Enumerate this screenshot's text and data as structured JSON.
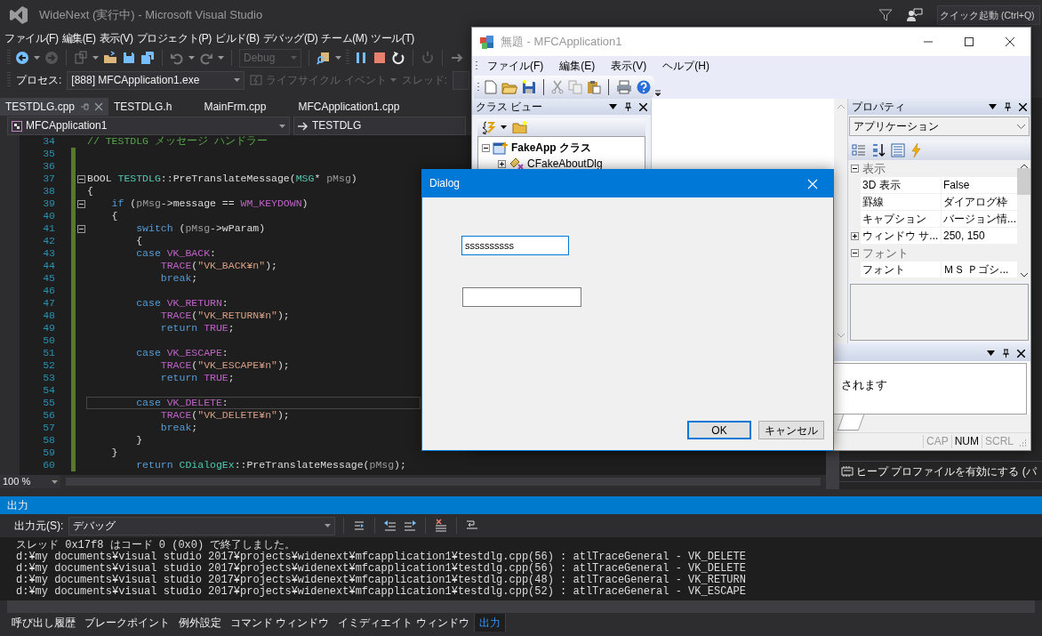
{
  "vs": {
    "title": "WideNext (実行中) - Microsoft Visual Studio",
    "quick_launch": {
      "placeholder": "クイック起動 (Ctrl+Q)"
    },
    "menu": [
      "ファイル(F)",
      "編集(E)",
      "表示(V)",
      "プロジェクト(P)",
      "ビルド(B)",
      "デバッグ(D)",
      "チーム(M)",
      "ツール(T)"
    ],
    "configuration": {
      "value": "Debug",
      "disabled": true
    },
    "process_bar": {
      "label": "プロセス:",
      "process": "[888] MFCApplication1.exe",
      "lifecycle": {
        "label": "ライフサイクル イベント",
        "disabled": true
      },
      "thread_label": "スレッド:"
    },
    "editor_tabs": [
      {
        "label": "TESTDLG.cpp",
        "selected": true
      },
      {
        "label": "TESTDLG.h",
        "selected": false
      },
      {
        "label": "MainFrm.cpp",
        "selected": false
      },
      {
        "label": "MFCApplication1.cpp",
        "selected": false
      }
    ],
    "nav": {
      "project": "MFCApplication1",
      "scope": "TESTDLG"
    },
    "code_lines": [
      {
        "number": "34",
        "changed": false,
        "fold": false,
        "current": false,
        "segments": [
          {
            "kind": "comment",
            "text": "// TESTDLG メッセージ ハンドラー"
          }
        ]
      },
      {
        "number": "35",
        "changed": true,
        "fold": false,
        "current": false
      },
      {
        "number": "36",
        "changed": true,
        "fold": false,
        "current": false
      },
      {
        "number": "37",
        "changed": true,
        "fold": true,
        "current": false,
        "segments": [
          {
            "kind": "plain",
            "text": "BOOL "
          },
          {
            "kind": "type",
            "text": "TESTDLG"
          },
          {
            "kind": "plain",
            "text": "::PreTranslateMessage("
          },
          {
            "kind": "type",
            "text": "MSG"
          },
          {
            "kind": "plain",
            "text": "* "
          },
          {
            "kind": "param",
            "text": "pMsg"
          },
          {
            "kind": "plain",
            "text": ")"
          }
        ]
      },
      {
        "number": "38",
        "changed": true,
        "fold": false,
        "current": false,
        "segments": [
          {
            "kind": "plain",
            "text": "{"
          }
        ]
      },
      {
        "number": "39",
        "changed": true,
        "fold": true,
        "current": false,
        "segments": [
          {
            "kind": "keyword",
            "text": "    if"
          },
          {
            "kind": "plain",
            "text": " ("
          },
          {
            "kind": "param",
            "text": "pMsg"
          },
          {
            "kind": "plain",
            "text": "->message == "
          },
          {
            "kind": "macro",
            "text": "WM_KEYDOWN"
          },
          {
            "kind": "plain",
            "text": ")"
          }
        ]
      },
      {
        "number": "40",
        "changed": true,
        "fold": false,
        "current": false,
        "segments": [
          {
            "kind": "plain",
            "text": "    {"
          }
        ]
      },
      {
        "number": "41",
        "changed": true,
        "fold": true,
        "current": false,
        "segments": [
          {
            "kind": "keyword",
            "text": "        switch"
          },
          {
            "kind": "plain",
            "text": " ("
          },
          {
            "kind": "param",
            "text": "pMsg"
          },
          {
            "kind": "plain",
            "text": "->wParam)"
          }
        ]
      },
      {
        "number": "42",
        "changed": true,
        "fold": false,
        "current": false,
        "segments": [
          {
            "kind": "plain",
            "text": "        {"
          }
        ]
      },
      {
        "number": "43",
        "changed": true,
        "fold": false,
        "current": false,
        "segments": [
          {
            "kind": "keyword",
            "text": "        case "
          },
          {
            "kind": "macro",
            "text": "VK_BACK"
          },
          {
            "kind": "plain",
            "text": ":"
          }
        ]
      },
      {
        "number": "44",
        "changed": true,
        "fold": false,
        "current": false,
        "segments": [
          {
            "kind": "macro",
            "text": "            TRACE"
          },
          {
            "kind": "plain",
            "text": "("
          },
          {
            "kind": "string",
            "text": "\"VK_BACK¥n\""
          },
          {
            "kind": "plain",
            "text": ");"
          }
        ]
      },
      {
        "number": "45",
        "changed": true,
        "fold": false,
        "current": false,
        "segments": [
          {
            "kind": "keyword",
            "text": "            break"
          },
          {
            "kind": "plain",
            "text": ";"
          }
        ]
      },
      {
        "number": "46",
        "changed": true,
        "fold": false,
        "current": false
      },
      {
        "number": "47",
        "changed": true,
        "fold": false,
        "current": false,
        "segments": [
          {
            "kind": "keyword",
            "text": "        case "
          },
          {
            "kind": "macro",
            "text": "VK_RETURN"
          },
          {
            "kind": "plain",
            "text": ":"
          }
        ]
      },
      {
        "number": "48",
        "changed": true,
        "fold": false,
        "current": false,
        "segments": [
          {
            "kind": "macro",
            "text": "            TRACE"
          },
          {
            "kind": "plain",
            "text": "("
          },
          {
            "kind": "string",
            "text": "\"VK_RETURN¥n\""
          },
          {
            "kind": "plain",
            "text": ");"
          }
        ]
      },
      {
        "number": "49",
        "changed": true,
        "fold": false,
        "current": false,
        "segments": [
          {
            "kind": "keyword",
            "text": "            return "
          },
          {
            "kind": "macro",
            "text": "TRUE"
          },
          {
            "kind": "plain",
            "text": ";"
          }
        ]
      },
      {
        "number": "50",
        "changed": true,
        "fold": false,
        "current": false
      },
      {
        "number": "51",
        "changed": true,
        "fold": false,
        "current": false,
        "segments": [
          {
            "kind": "keyword",
            "text": "        case "
          },
          {
            "kind": "macro",
            "text": "VK_ESCAPE"
          },
          {
            "kind": "plain",
            "text": ":"
          }
        ]
      },
      {
        "number": "52",
        "changed": true,
        "fold": false,
        "current": false,
        "segments": [
          {
            "kind": "macro",
            "text": "            TRACE"
          },
          {
            "kind": "plain",
            "text": "("
          },
          {
            "kind": "string",
            "text": "\"VK_ESCAPE¥n\""
          },
          {
            "kind": "plain",
            "text": ");"
          }
        ]
      },
      {
        "number": "53",
        "changed": true,
        "fold": false,
        "current": false,
        "segments": [
          {
            "kind": "keyword",
            "text": "            return "
          },
          {
            "kind": "macro",
            "text": "TRUE"
          },
          {
            "kind": "plain",
            "text": ";"
          }
        ]
      },
      {
        "number": "54",
        "changed": true,
        "fold": false,
        "current": false
      },
      {
        "number": "55",
        "changed": true,
        "fold": false,
        "current": true,
        "segments": [
          {
            "kind": "keyword",
            "text": "        case "
          },
          {
            "kind": "macro",
            "text": "VK_DELETE"
          },
          {
            "kind": "plain",
            "text": ":"
          }
        ]
      },
      {
        "number": "56",
        "changed": true,
        "fold": false,
        "current": false,
        "segments": [
          {
            "kind": "macro",
            "text": "            TRACE"
          },
          {
            "kind": "plain",
            "text": "("
          },
          {
            "kind": "string",
            "text": "\"VK_DELETE¥n\""
          },
          {
            "kind": "plain",
            "text": ");"
          }
        ]
      },
      {
        "number": "57",
        "changed": true,
        "fold": false,
        "current": false,
        "segments": [
          {
            "kind": "keyword",
            "text": "            break"
          },
          {
            "kind": "plain",
            "text": ";"
          }
        ]
      },
      {
        "number": "58",
        "changed": true,
        "fold": false,
        "current": false,
        "segments": [
          {
            "kind": "plain",
            "text": "        }"
          }
        ]
      },
      {
        "number": "59",
        "changed": true,
        "fold": false,
        "current": false,
        "segments": [
          {
            "kind": "plain",
            "text": "    }"
          }
        ]
      },
      {
        "number": "60",
        "changed": true,
        "fold": false,
        "current": false,
        "segments": [
          {
            "kind": "keyword",
            "text": "        return "
          },
          {
            "kind": "type",
            "text": "CDialogEx"
          },
          {
            "kind": "plain",
            "text": "::PreTranslateMessage("
          },
          {
            "kind": "param",
            "text": "pMsg"
          },
          {
            "kind": "plain",
            "text": ");"
          }
        ]
      }
    ],
    "zoom": "100 %",
    "diagnostics": {
      "items": [
        "ヒープ プロファイルを有効にする (パ"
      ]
    },
    "output": {
      "title": "出力",
      "source_label": "出力元(S):",
      "source": "デバッグ",
      "lines": [
        "スレッド 0x17f8 はコード 0 (0x0) で終了しました。",
        "d:¥my documents¥visual studio 2017¥projects¥widenext¥mfcapplication1¥testdlg.cpp(56) : atlTraceGeneral - VK_DELETE",
        "d:¥my documents¥visual studio 2017¥projects¥widenext¥mfcapplication1¥testdlg.cpp(56) : atlTraceGeneral - VK_DELETE",
        "d:¥my documents¥visual studio 2017¥projects¥widenext¥mfcapplication1¥testdlg.cpp(48) : atlTraceGeneral - VK_RETURN",
        "d:¥my documents¥visual studio 2017¥projects¥widenext¥mfcapplication1¥testdlg.cpp(52) : atlTraceGeneral - VK_ESCAPE"
      ]
    },
    "bottom_tabs": [
      {
        "label": "呼び出し履歴",
        "selected": false
      },
      {
        "label": "ブレークポイント",
        "selected": false
      },
      {
        "label": "例外設定",
        "selected": false
      },
      {
        "label": "コマンド ウィンドウ",
        "selected": false
      },
      {
        "label": "イミディエイト ウィンドウ",
        "selected": false
      },
      {
        "label": "出力",
        "selected": true
      }
    ]
  },
  "app": {
    "title": "無題 - MFCApplication1",
    "menu": [
      "ファイル(F)",
      "編集(E)",
      "表示(V)",
      "ヘルプ(H)"
    ],
    "class_view": {
      "title": "クラス ビュー",
      "tree": [
        {
          "label": "FakeApp クラス",
          "expanded": true,
          "children": [
            {
              "label": "CFakeAboutDlg",
              "expanded": false
            }
          ]
        }
      ]
    },
    "properties": {
      "title": "プロパティ",
      "object": "アプリケーション",
      "groups": [
        {
          "name": "表示",
          "expanded": true,
          "rows": [
            {
              "name": "3D 表示",
              "value": "False",
              "kind": "plain"
            },
            {
              "name": "罫線",
              "value": "ダイアログ枠",
              "kind": "plain"
            },
            {
              "name": "キャプション",
              "value": "バージョン情...",
              "kind": "plain"
            },
            {
              "name": "ウィンドウ サ...",
              "value": "250, 150",
              "kind": "collapsed"
            }
          ]
        },
        {
          "name": "フォント",
          "expanded": true,
          "rows": [
            {
              "name": "フォント",
              "value": "ＭＳ Ｐゴシ...",
              "kind": "plain"
            }
          ]
        }
      ]
    },
    "output_text": "されます",
    "status": [
      {
        "label": "CAP",
        "on": false
      },
      {
        "label": "NUM",
        "on": true
      },
      {
        "label": "SCRL",
        "on": false
      }
    ]
  },
  "dialog": {
    "title": "Dialog",
    "fields": [
      {
        "value": "ssssssssss",
        "focused": true
      },
      {
        "focused": false
      }
    ],
    "buttons": [
      {
        "label": "OK",
        "default": true
      },
      {
        "label": "キャンセル",
        "default": false
      }
    ]
  }
}
